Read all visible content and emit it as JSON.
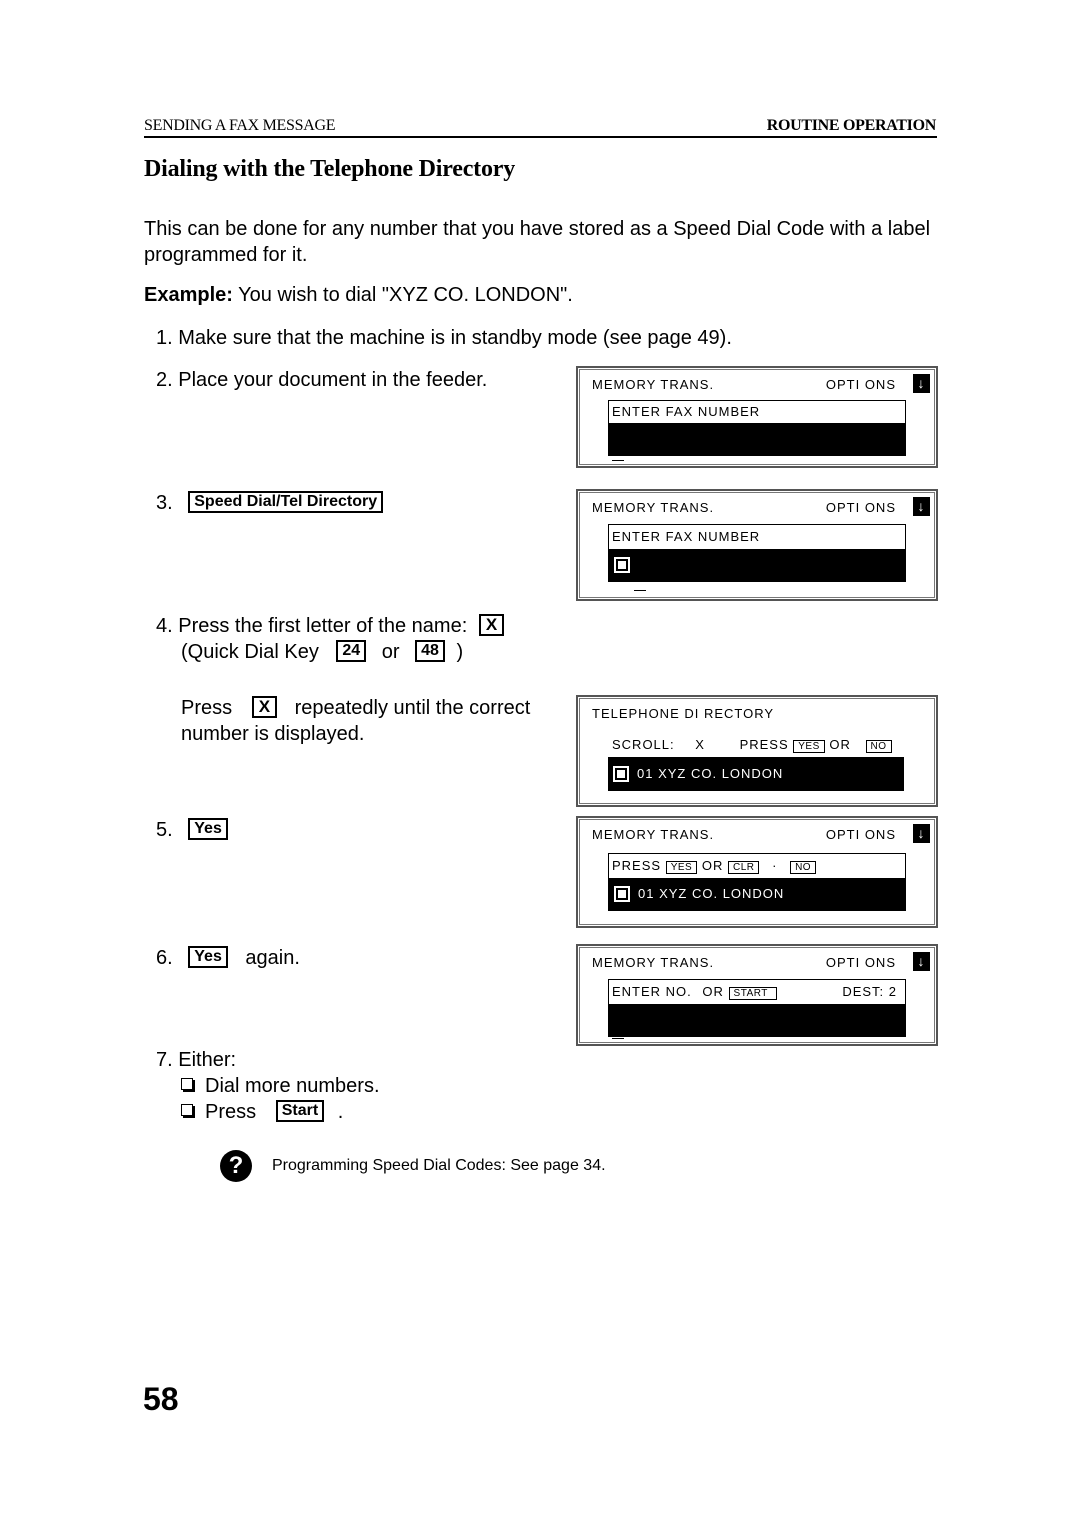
{
  "header": {
    "section": "SENDING A FAX MESSAGE",
    "chapter": "ROUTINE OPERATION"
  },
  "title": "Dialing with the Telephone Directory",
  "intro": "This can be done for any number that you have stored as a Speed Dial Code with a label programmed for it.",
  "example": {
    "label": "Example:",
    "text": " You wish to dial \"XYZ CO. LONDON\"."
  },
  "steps": {
    "s1": "1. Make sure that the machine is in standby mode (see page 49).",
    "s2": "2. Place your document in the feeder.",
    "s3_num": "3.",
    "s3_key": "Speed Dial/Tel Directory",
    "s4_text": "4. Press the first letter of the name:",
    "s4_key": "X",
    "s4_quick": "(Quick Dial Key",
    "s4_key24": "24",
    "s4_or": "or",
    "s4_key48": "48",
    "s4_close": ")",
    "s4b_press": "Press",
    "s4b_key": "X",
    "s4b_rest": "repeatedly until the correct",
    "s4b_line2": "number is displayed.",
    "s5_num": "5.",
    "s5_key": "Yes",
    "s6_num": "6.",
    "s6_key": "Yes",
    "s6_text": "again.",
    "s7": "7. Either:",
    "s7_opt1": "Dial more numbers.",
    "s7_opt2": "Press",
    "s7_key": "Start",
    "s7_end": "."
  },
  "lcd": {
    "d1": {
      "top": "MEMORY TRANS.",
      "opt": "OPTI ONS",
      "arrow": "↓",
      "line1": "ENTER FAX NUMBER"
    },
    "d2": {
      "top": "MEMORY TRANS.",
      "opt": "OPTI ONS",
      "arrow": "↓",
      "line1": "ENTER FAX NUMBER"
    },
    "d3": {
      "top": "TELEPHONE DI RECTORY",
      "scroll": "SCROLL:",
      "x": "X",
      "press": "PRESS",
      "yes": "YES",
      "or": "OR",
      "no": "NO",
      "entry": "01 XYZ CO. LONDON"
    },
    "d4": {
      "top": "MEMORY TRANS.",
      "opt": "OPTI ONS",
      "arrow": "↓",
      "press": "PRESS",
      "yes": "YES",
      "or": "OR",
      "clr": "CLR",
      "dot": "·",
      "no": "NO",
      "entry": "01 XYZ CO. LONDON"
    },
    "d5": {
      "top": "MEMORY TRANS.",
      "opt": "OPTI ONS",
      "arrow": "↓",
      "enter": "ENTER NO.",
      "or": "OR",
      "start": "START",
      "dest": "DEST: 2"
    }
  },
  "note": {
    "icon": "?",
    "text": "Programming Speed Dial Codes: See page 34."
  },
  "page_number": "58"
}
